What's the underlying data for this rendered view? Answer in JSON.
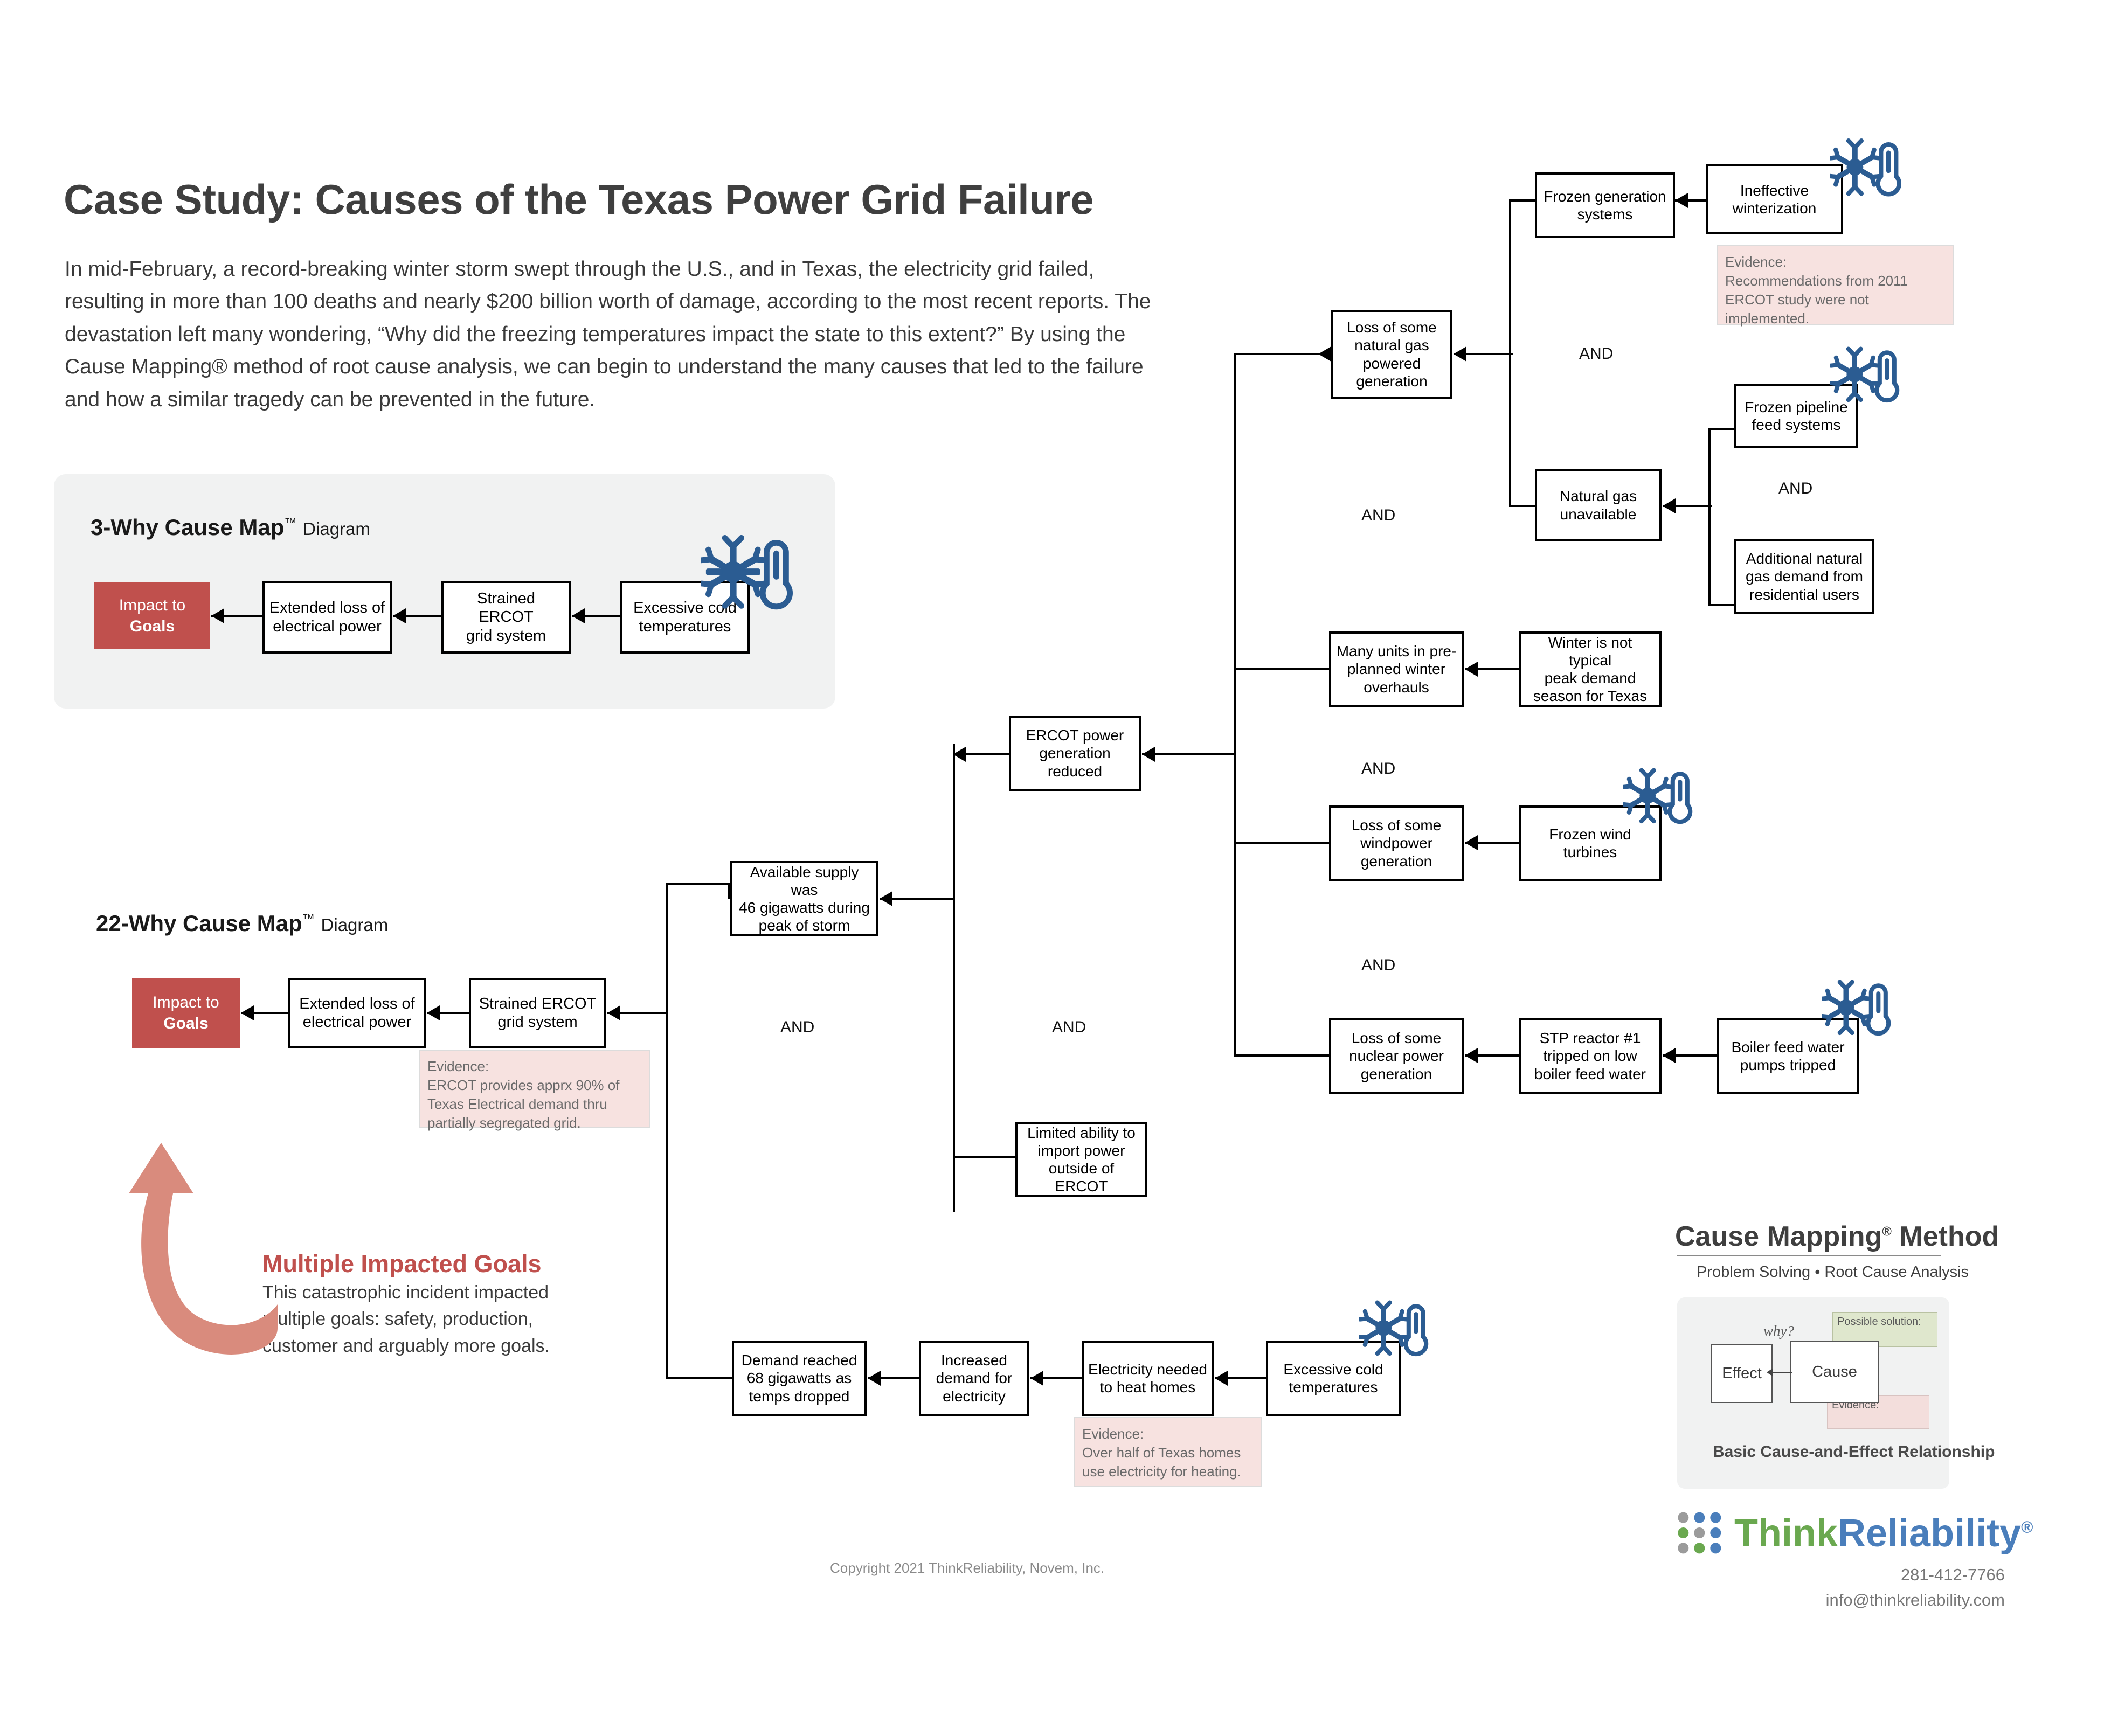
{
  "header": {
    "title": "Case Study: Causes of the Texas Power Grid Failure",
    "intro": "In mid-February, a record-breaking winter storm swept through the U.S., and in Texas, the electricity grid failed, resulting in more than 100 deaths and nearly $200 billion worth of damage, according to the most recent reports. The devastation left many wondering, “Why did the freezing temperatures impact the state to this extent?” By using the Cause Mapping® method of root cause analysis, we can begin to understand the many causes that led to the failure and how a similar tragedy can be prevented in the future."
  },
  "three_why": {
    "label_bold": "3-Why Cause Map",
    "label_tm": "™",
    "label_sub": "Diagram",
    "goal_line1": "Impact to",
    "goal_line2": "Goals",
    "boxes": [
      {
        "id": "tw-extended-loss",
        "lines": [
          "Extended loss of",
          "electrical power"
        ]
      },
      {
        "id": "tw-strained-ercot",
        "lines": [
          "Strained ERCOT",
          "grid system"
        ]
      },
      {
        "id": "tw-cold-temps",
        "lines": [
          "Excessive cold",
          "temperatures"
        ]
      }
    ]
  },
  "twentytwo_why": {
    "label_bold": "22-Why Cause Map",
    "label_tm": "™",
    "label_sub": "Diagram",
    "goal_line1": "Impact to",
    "goal_line2": "Goals",
    "and_label": "AND",
    "boxes": {
      "extended_loss": [
        "Extended loss of",
        "electrical power"
      ],
      "strained_ercot": [
        "Strained ERCOT",
        "grid system"
      ],
      "available_supply": [
        "Available supply was",
        "46 gigawatts during",
        "peak of storm"
      ],
      "limited_import": [
        "Limited ability to",
        "import power",
        "outside of ERCOT"
      ],
      "ercot_reduced": [
        "ERCOT power",
        "generation reduced"
      ],
      "loss_natural_gas": [
        "Loss of some",
        "natural gas",
        "powered",
        "generation"
      ],
      "frozen_generation": [
        "Frozen generation",
        "systems"
      ],
      "ineffective_winterization": [
        "Ineffective",
        "winterization"
      ],
      "natural_gas_unavailable": [
        "Natural gas",
        "unavailable"
      ],
      "frozen_pipeline": [
        "Frozen pipeline",
        "feed systems"
      ],
      "additional_demand": [
        "Additional natural",
        "gas demand from",
        "residential users"
      ],
      "pre_planned_overhauls": [
        "Many units in pre-",
        "planned winter",
        "overhauls"
      ],
      "winter_not_peak": [
        "Winter is not typical",
        "peak demand",
        "season for Texas"
      ],
      "loss_windpower": [
        "Loss of some",
        "windpower",
        "generation"
      ],
      "frozen_wind_turbines": [
        "Frozen wind",
        "turbines"
      ],
      "loss_nuclear": [
        "Loss of some",
        "nuclear power",
        "generation"
      ],
      "stp_reactor": [
        "STP reactor #1",
        "tripped on low",
        "boiler feed water"
      ],
      "boiler_pumps": [
        "Boiler feed water",
        "pumps tripped"
      ],
      "demand_reached": [
        "Demand reached",
        "68 gigawatts as",
        "temps dropped"
      ],
      "increased_demand": [
        "Increased",
        "demand for",
        "electricity"
      ],
      "electricity_heat": [
        "Electricity needed",
        "to heat homes"
      ],
      "cold_temps_bottom": [
        "Excessive cold",
        "temperatures"
      ]
    },
    "evidence": {
      "ercot_grid": [
        "Evidence:",
        "ERCOT provides apprx 90% of",
        "Texas Electrical demand thru",
        "partially segregated grid."
      ],
      "winterization": [
        "Evidence:",
        "Recommendations from 2011",
        "ERCOT study were not",
        "implemented."
      ],
      "heating": [
        "Evidence:",
        "Over half of Texas homes",
        "use electricity for heating."
      ]
    }
  },
  "callout": {
    "title": "Multiple Impacted Goals",
    "body": "This catastrophic incident impacted multiple goals: safety, production, customer and arguably more goals."
  },
  "cause_mapping_legend": {
    "title": "Cause Mapping",
    "title_reg": "®",
    "title_tail": "Method",
    "subtitle": "Problem Solving • Root Cause Analysis",
    "effect_label": "Effect",
    "cause_label": "Cause",
    "why_label": "why?",
    "solution_label": "Possible solution:",
    "evidence_label": "Evidence:",
    "caption": "Basic Cause-and-Effect Relationship"
  },
  "footer": {
    "logo_think": "Think",
    "logo_reliability": "Reliability",
    "logo_reg": "®",
    "phone": "281-412-7766",
    "email": "info@thinkreliability.com",
    "copyright": "Copyright 2021 ThinkReliability, Novem, Inc."
  },
  "colors": {
    "goal_red": "#c0504d",
    "evidence_pink": "#f7e2e0",
    "panel_gray": "#f1f2f2",
    "icon_blue": "#2b5c92",
    "callout_red": "#d98b7d",
    "logo_green": "#6aa84f",
    "logo_blue": "#4a7ebb"
  }
}
